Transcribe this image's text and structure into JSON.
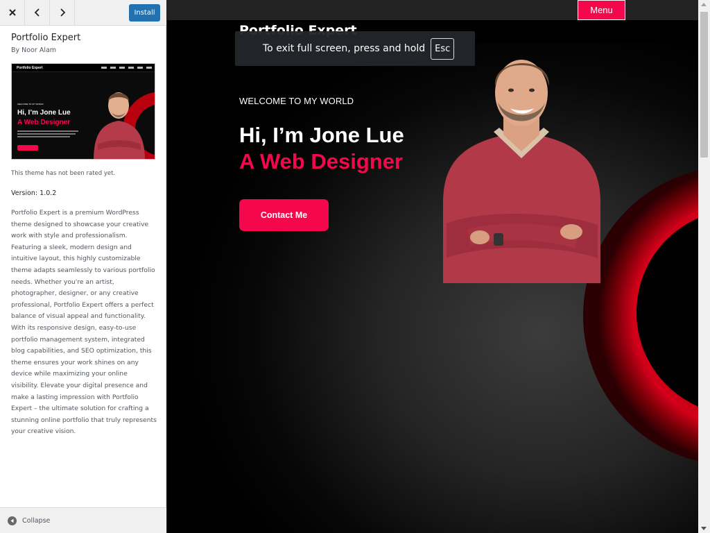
{
  "sidebar": {
    "header": {
      "close_icon": "close-icon",
      "prev_icon": "chevron-left-icon",
      "next_icon": "chevron-right-icon",
      "install_label": "Install"
    },
    "theme_name": "Portfolio Expert",
    "theme_author": "By Noor Alam",
    "screenshot": {
      "logo": "Portfolio Expert",
      "welcome": "WELCOME TO MY WORLD",
      "line1": "Hi, I’m Jone Lue",
      "line2": "A Web Designer"
    },
    "rating_text": "This theme has not been rated yet.",
    "version_text": "Version: 1.0.2",
    "description": "Portfolio Expert is a premium WordPress theme designed to showcase your creative work with style and professionalism. Featuring a sleek, modern design and intuitive layout, this highly customizable theme adapts seamlessly to various portfolio needs. Whether you're an artist, photographer, designer, or any creative professional, Portfolio Expert offers a perfect balance of visual appeal and functionality. With its responsive design, easy-to-use portfolio management system, integrated blog capabilities, and SEO optimization, this theme ensures your work shines on any device while maximizing your online visibility. Elevate your digital presence and make a lasting impression with Portfolio Expert – the ultimate solution for crafting a stunning online portfolio that truly represents your creative vision.",
    "collapse_label": "Collapse"
  },
  "preview": {
    "site_title": "Portfolio Expert",
    "menu_label": "Menu",
    "welcome": "WELCOME TO MY WORLD",
    "hero_line1": "Hi, I’m Jone Lue",
    "hero_line2": "A Web Designer",
    "contact_label": "Contact Me",
    "fullscreen_notice": "To exit full screen, press and hold",
    "esc_key": "Esc"
  },
  "colors": {
    "accent": "#f5074c",
    "wp_blue": "#2271b1",
    "dark_bg": "#000000"
  }
}
